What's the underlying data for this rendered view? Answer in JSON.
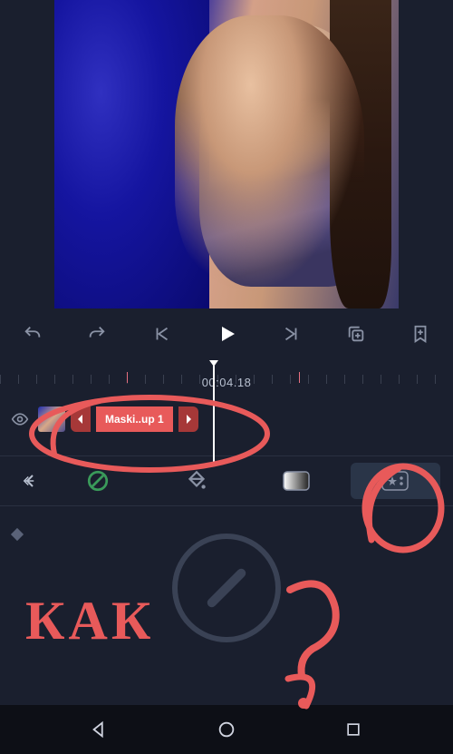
{
  "toolbar": {
    "undo": "undo-icon",
    "redo": "redo-icon",
    "prev": "skip-start-icon",
    "play": "play-icon",
    "next": "skip-end-icon",
    "duplicate": "duplicate-icon",
    "add": "bookmark-add-icon"
  },
  "timeline": {
    "timecode": "00:04.18"
  },
  "track": {
    "clip_label": "Maski..up 1"
  },
  "edit_tabs": {
    "none_label": "none",
    "fill_label": "fill",
    "mask_label": "mask",
    "effects_label": "effects"
  },
  "annotation": {
    "text": "КАК",
    "question": "?"
  },
  "navbar": {
    "back": "back",
    "home": "home",
    "recent": "recent"
  }
}
